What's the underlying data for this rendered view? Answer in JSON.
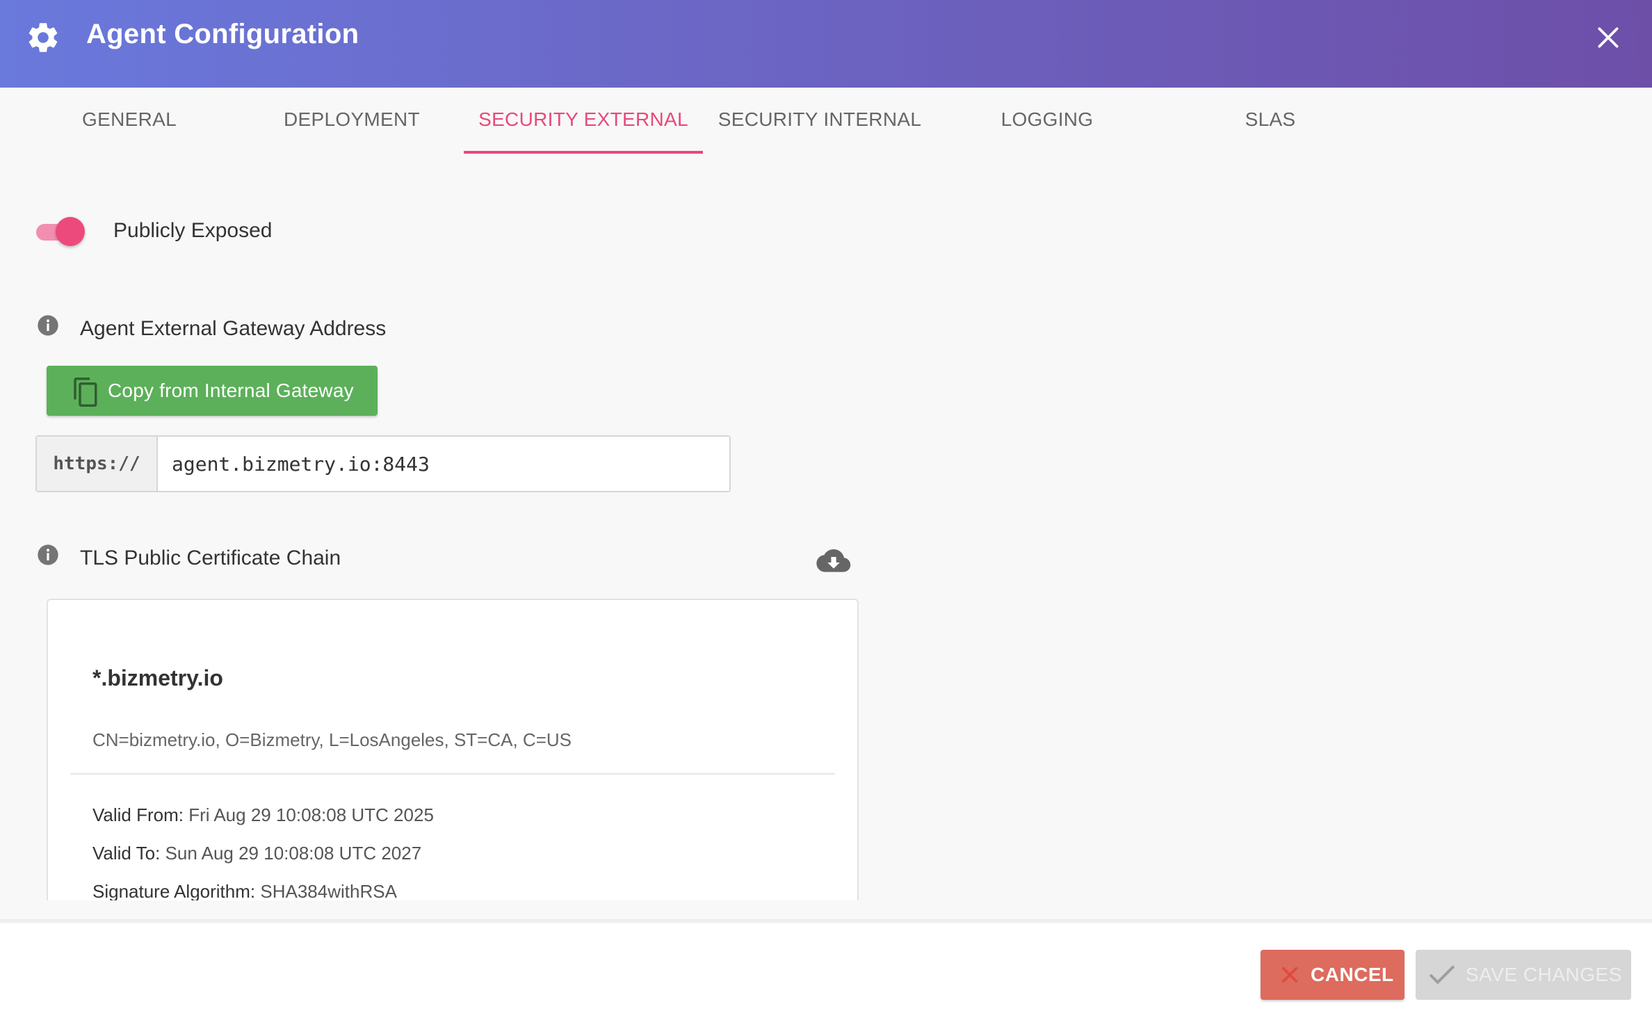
{
  "dialog": {
    "title": "Agent Configuration",
    "icon": "gear-icon",
    "close_icon": "close-icon"
  },
  "tabs": [
    {
      "label": "GENERAL",
      "active": false
    },
    {
      "label": "DEPLOYMENT",
      "active": false
    },
    {
      "label": "SECURITY EXTERNAL",
      "active": true
    },
    {
      "label": "SECURITY INTERNAL",
      "active": false
    },
    {
      "label": "LOGGING",
      "active": false
    },
    {
      "label": "SLAS",
      "active": false
    }
  ],
  "exposure": {
    "label": "Publicly Exposed",
    "enabled": true
  },
  "gateway": {
    "label": "Agent External Gateway Address",
    "copy_button": "Copy from Internal Gateway",
    "prefix": "https://",
    "value": "agent.bizmetry.io:8443"
  },
  "certificate": {
    "label": "TLS Public Certificate Chain",
    "download_icon": "cloud-download-icon",
    "name": "*.bizmetry.io",
    "subject": "CN=bizmetry.io, O=Bizmetry, L=LosAngeles, ST=CA, C=US",
    "valid_from_label": "Valid From:",
    "valid_from": "Fri Aug 29 10:08:08 UTC 2025",
    "valid_to_label": "Valid To:",
    "valid_to": "Sun Aug 29 10:08:08 UTC 2027",
    "sig_alg_label": "Signature Algorithm:",
    "sig_alg": "SHA384withRSA"
  },
  "footer": {
    "cancel": "CANCEL",
    "save": "SAVE CHANGES"
  },
  "colors": {
    "accent": "#e8497a",
    "header_start": "#6a79dc",
    "header_end": "#6d4fa8",
    "copy_button": "#5cb05a",
    "cancel_button": "#dd6b5e",
    "save_disabled": "#d6d6d6"
  }
}
